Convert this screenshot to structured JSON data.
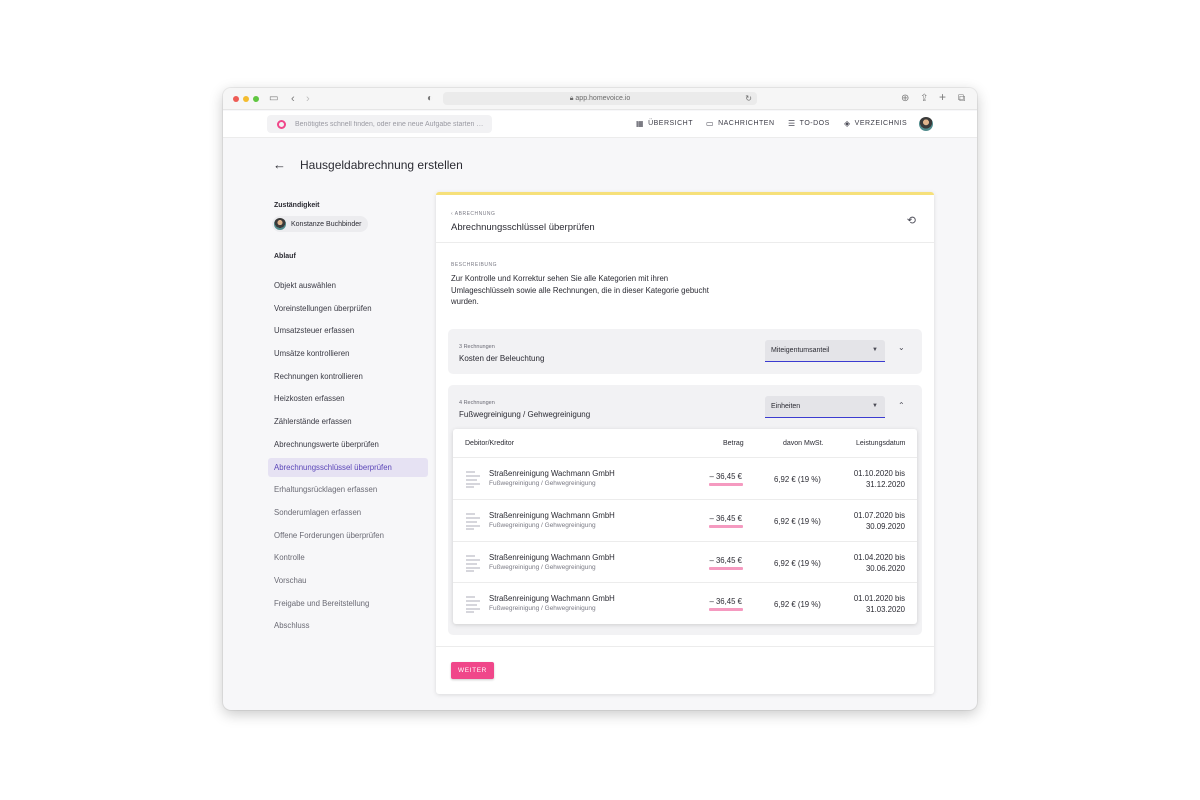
{
  "browser": {
    "url": "app.homevoice.io"
  },
  "appnav": {
    "search_placeholder": "Benötigtes schnell finden, oder eine neue Aufgabe starten …",
    "items": [
      {
        "label": "ÜBERSICHT",
        "icon": "dashboard-icon"
      },
      {
        "label": "NACHRICHTEN",
        "icon": "message-icon"
      },
      {
        "label": "TO-DOS",
        "icon": "list-icon"
      },
      {
        "label": "VERZEICHNIS",
        "icon": "layers-icon"
      }
    ]
  },
  "page": {
    "title": "Hausgeldabrechnung erstellen"
  },
  "sidebar": {
    "responsible_label": "Zuständigkeit",
    "responsible_name": "Konstanze Buchbinder",
    "flow_label": "Ablauf",
    "steps": [
      {
        "label": "Objekt auswählen",
        "state": "done"
      },
      {
        "label": "Voreinstellungen überprüfen",
        "state": "done"
      },
      {
        "label": "Umsatzsteuer erfassen",
        "state": "done"
      },
      {
        "label": "Umsätze kontrollieren",
        "state": "done"
      },
      {
        "label": "Rechnungen kontrollieren",
        "state": "done"
      },
      {
        "label": "Heizkosten erfassen",
        "state": "done"
      },
      {
        "label": "Zählerstände erfassen",
        "state": "done"
      },
      {
        "label": "Abrechnungswerte überprüfen",
        "state": "done"
      },
      {
        "label": "Abrechnungsschlüssel überprüfen",
        "state": "active"
      },
      {
        "label": "Erhaltungsrücklagen erfassen",
        "state": "future"
      },
      {
        "label": "Sonderumlagen erfassen",
        "state": "future"
      },
      {
        "label": "Offene Forderungen überprüfen",
        "state": "future"
      },
      {
        "label": "Kontrolle",
        "state": "future"
      },
      {
        "label": "Vorschau",
        "state": "future"
      },
      {
        "label": "Freigabe und Bereitstellung",
        "state": "future"
      },
      {
        "label": "Abschluss",
        "state": "future"
      }
    ]
  },
  "card": {
    "breadcrumb": "ABRECHNUNG",
    "title": "Abrechnungsschlüssel überprüfen",
    "desc_label": "BESCHREIBUNG",
    "description": "Zur Kontrolle und Korrektur sehen Sie alle Kategorien mit ihren Umlageschlüsseln sowie alle Rechnungen, die in dieser Kategorie gebucht wurden.",
    "groups": [
      {
        "count": "3 Rechnungen",
        "name": "Kosten der Beleuchtung",
        "key": "Miteigentumsanteil",
        "expanded": false
      },
      {
        "count": "4 Rechnungen",
        "name": "Fußwegreinigung / Gehwegreinigung",
        "key": "Einheiten",
        "expanded": true
      }
    ],
    "table": {
      "headers": {
        "creditor": "Debitor/Kreditor",
        "amount": "Betrag",
        "vat": "davon MwSt.",
        "date": "Leistungsdatum"
      },
      "rows": [
        {
          "name": "Straßenreinigung Wachmann GmbH",
          "category": "Fußwegreinigung / Gehwegreinigung",
          "amount": "– 36,45 €",
          "vat": "6,92 € (19 %)",
          "date_from": "01.10.2020 bis",
          "date_to": "31.12.2020"
        },
        {
          "name": "Straßenreinigung Wachmann GmbH",
          "category": "Fußwegreinigung / Gehwegreinigung",
          "amount": "– 36,45 €",
          "vat": "6,92 € (19 %)",
          "date_from": "01.07.2020 bis",
          "date_to": "30.09.2020"
        },
        {
          "name": "Straßenreinigung Wachmann GmbH",
          "category": "Fußwegreinigung / Gehwegreinigung",
          "amount": "– 36,45 €",
          "vat": "6,92 € (19 %)",
          "date_from": "01.04.2020 bis",
          "date_to": "30.06.2020"
        },
        {
          "name": "Straßenreinigung Wachmann GmbH",
          "category": "Fußwegreinigung / Gehwegreinigung",
          "amount": "– 36,45 €",
          "vat": "6,92 € (19 %)",
          "date_from": "01.01.2020 bis",
          "date_to": "31.03.2020"
        }
      ]
    },
    "next_button": "WEITER"
  },
  "colors": {
    "accent": "#f0478a",
    "active_step_bg": "#e6e2f3",
    "active_step_text": "#5b46b8",
    "select_underline": "#3b3bd0",
    "amount_bar": "#f59ac0",
    "card_top_line": "#f6e07a"
  }
}
